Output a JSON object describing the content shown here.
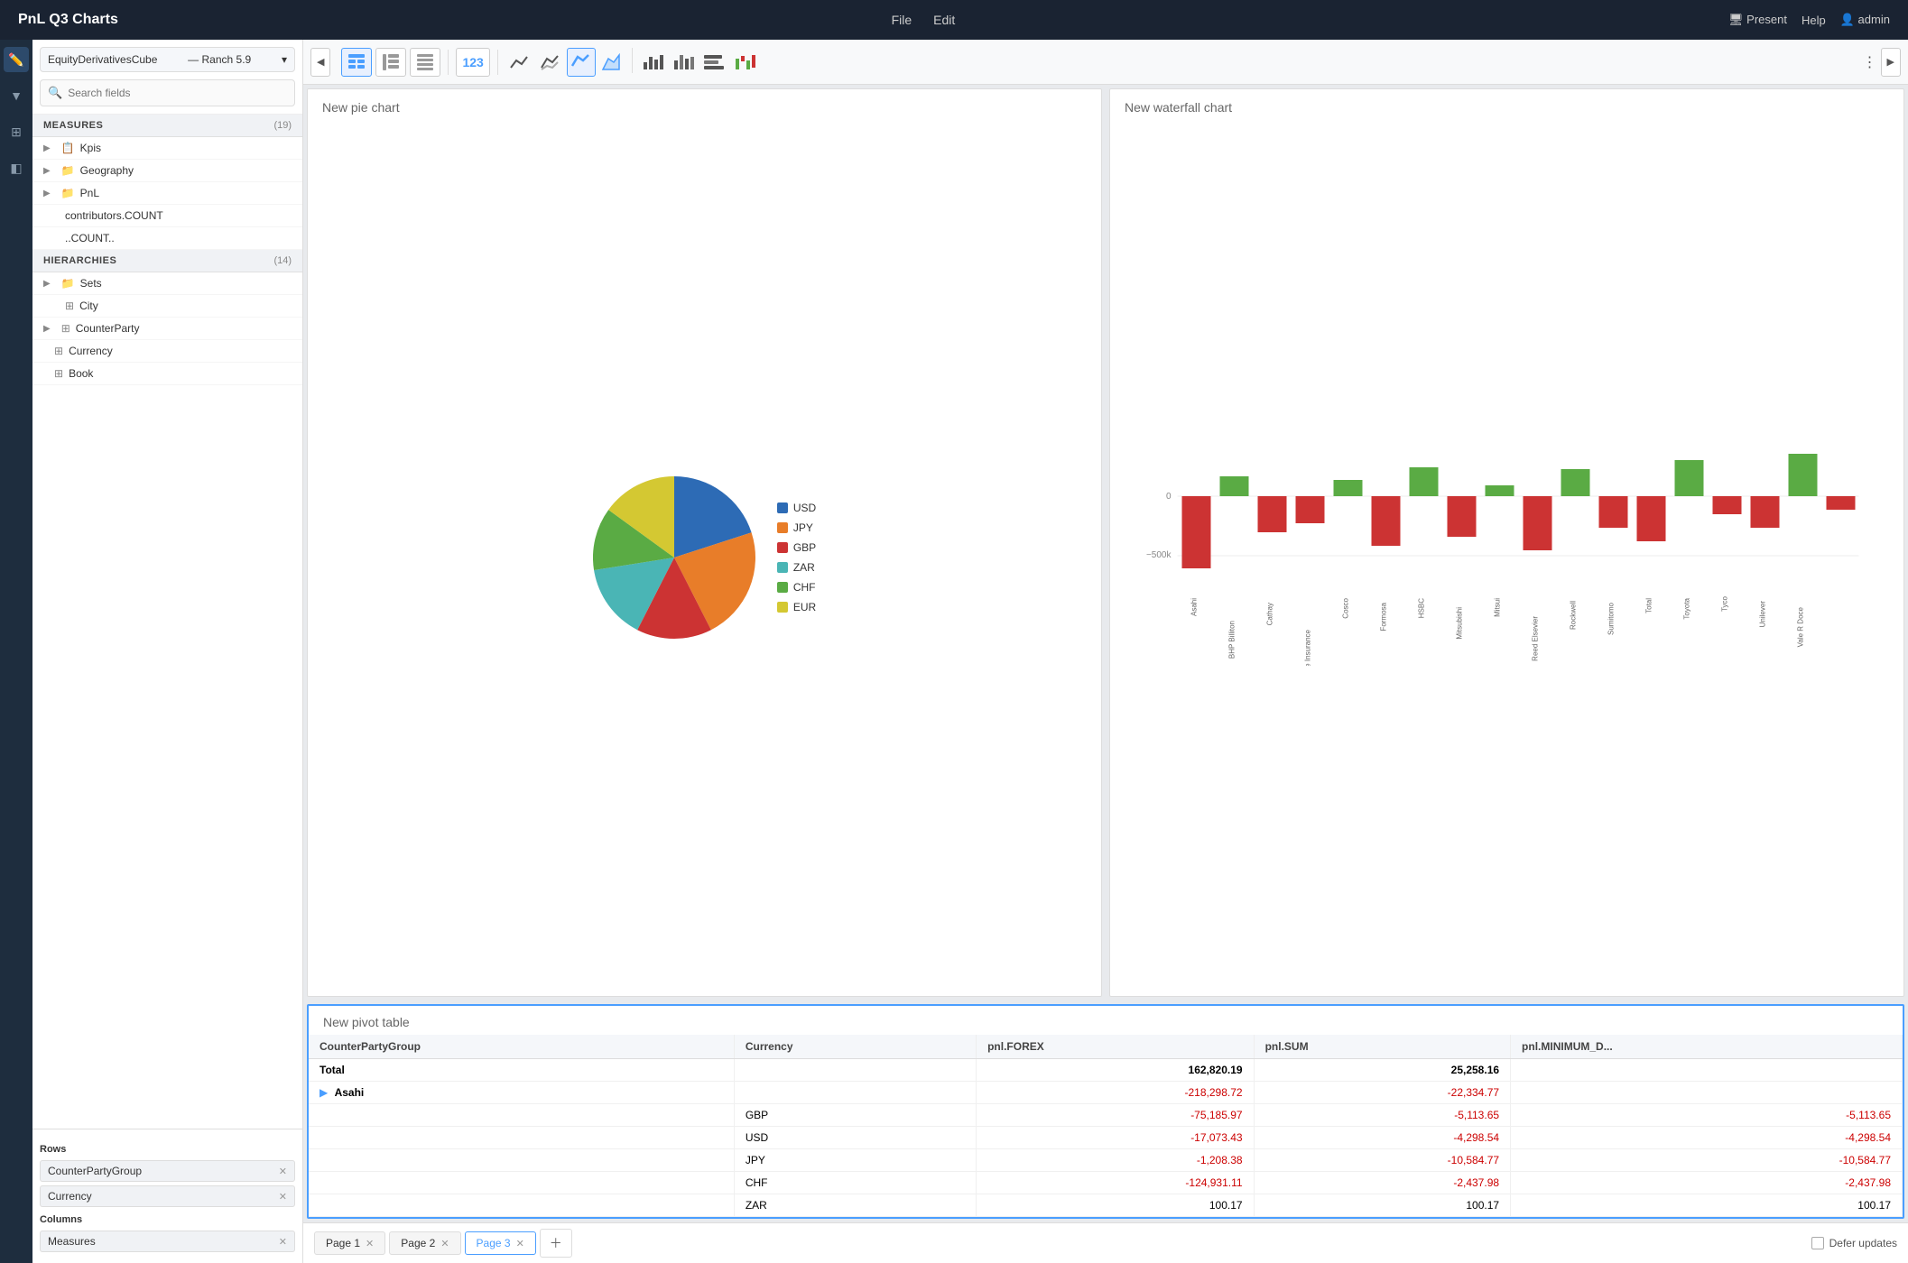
{
  "app": {
    "title": "PnL Q3 Charts",
    "nav": [
      "File",
      "Edit"
    ],
    "actions": [
      "Present",
      "Help",
      "admin"
    ],
    "present_label": "Present",
    "help_label": "Help",
    "user_label": "admin"
  },
  "cube_selector": {
    "label": "EquityDerivativesCube",
    "sub": "Ranch 5.9"
  },
  "search": {
    "placeholder": "Search fields"
  },
  "measures_section": {
    "title": "MEASURES",
    "count": "(19)",
    "items": [
      {
        "label": "Kpis",
        "indent": 0,
        "expandable": true,
        "icon": "📋"
      },
      {
        "label": "Geography",
        "indent": 0,
        "expandable": true,
        "icon": "📁"
      },
      {
        "label": "PnL",
        "indent": 0,
        "expandable": true,
        "icon": "📁"
      },
      {
        "label": "contributors.COUNT",
        "indent": 1,
        "expandable": false,
        "icon": ""
      },
      {
        "label": "..COUNT..",
        "indent": 1,
        "expandable": false,
        "icon": ""
      }
    ]
  },
  "hierarchies_section": {
    "title": "HIERARCHIES",
    "count": "(14)",
    "items": [
      {
        "label": "Sets",
        "indent": 0,
        "expandable": true,
        "icon": "📁"
      },
      {
        "label": "City",
        "indent": 0,
        "expandable": false,
        "icon": "🏙"
      },
      {
        "label": "CounterParty",
        "indent": 0,
        "expandable": true,
        "icon": "🏙"
      },
      {
        "label": "Currency",
        "indent": 0,
        "expandable": false,
        "icon": "🏙"
      },
      {
        "label": "Book",
        "indent": 0,
        "expandable": false,
        "icon": "🏙"
      }
    ]
  },
  "rows_section": {
    "label": "Rows",
    "pills": [
      {
        "label": "CounterPartyGroup"
      },
      {
        "label": "Currency"
      }
    ]
  },
  "columns_section": {
    "label": "Columns",
    "pills": [
      {
        "label": "Measures"
      }
    ]
  },
  "charts": {
    "pie": {
      "title": "New pie chart",
      "legend": [
        {
          "label": "USD",
          "color": "#2d6bb5"
        },
        {
          "label": "JPY",
          "color": "#e87d29"
        },
        {
          "label": "GBP",
          "color": "#cc3333"
        },
        {
          "label": "ZAR",
          "color": "#4ab5b5"
        },
        {
          "label": "CHF",
          "color": "#5aab44"
        },
        {
          "label": "EUR",
          "color": "#d4c832"
        }
      ]
    },
    "waterfall": {
      "title": "New waterfall chart",
      "labels": [
        "Asahi",
        "BHP Billiton",
        "Cathay",
        "China Life Insurance",
        "Cosco",
        "Formosa",
        "HSBC",
        "Mitsubishi",
        "Mitsui",
        "Reed Elsevier",
        "Rockwell",
        "Sumitomo",
        "Total",
        "Toyota",
        "Tyco",
        "Unilever",
        "Vale R Doce"
      ]
    },
    "pivot": {
      "title": "New pivot table",
      "columns": [
        "CounterPartyGroup",
        "Currency",
        "pnl.FOREX",
        "pnl.SUM",
        "pnl.MINIMUM_D..."
      ],
      "total_row": {
        "counterparty": "Total",
        "currency": "",
        "forex": "162,820.19",
        "sum": "25,258.16",
        "min": ""
      },
      "rows": [
        {
          "counterparty": "Asahi",
          "currency": "",
          "forex": "-218,298.72",
          "sum": "-22,334.77",
          "min": "",
          "expandable": true,
          "children": [
            {
              "counterparty": "",
              "currency": "GBP",
              "forex": "-75,185.97",
              "sum": "-5,113.65",
              "min": "-5,113.65",
              "neg_forex": true,
              "neg_sum": true,
              "neg_min": true
            },
            {
              "counterparty": "",
              "currency": "USD",
              "forex": "-17,073.43",
              "sum": "-4,298.54",
              "min": "-4,298.54",
              "neg_forex": true,
              "neg_sum": true,
              "neg_min": true
            },
            {
              "counterparty": "",
              "currency": "JPY",
              "forex": "-1,208.38",
              "sum": "-10,584.77",
              "min": "-10,584.77",
              "neg_forex": true,
              "neg_sum": true,
              "neg_min": true
            },
            {
              "counterparty": "",
              "currency": "CHF",
              "forex": "-124,931.11",
              "sum": "-2,437.98",
              "min": "-2,437.98",
              "neg_forex": true,
              "neg_sum": true,
              "neg_min": true
            },
            {
              "counterparty": "",
              "currency": "ZAR",
              "forex": "100.17",
              "sum": "100.17",
              "min": "100.17",
              "neg_forex": false,
              "neg_sum": false,
              "neg_min": false
            }
          ]
        }
      ]
    }
  },
  "pages": [
    {
      "label": "Page 1",
      "active": false
    },
    {
      "label": "Page 2",
      "active": false
    },
    {
      "label": "Page 3",
      "active": true
    }
  ],
  "defer_updates_label": "Defer updates",
  "toolbar": {
    "number_icon": "123"
  }
}
